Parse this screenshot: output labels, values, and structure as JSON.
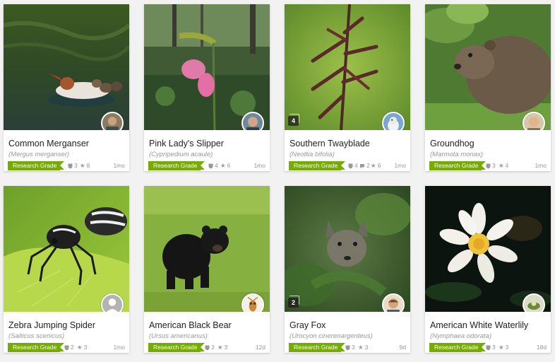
{
  "colors": {
    "badge": "#74ac00",
    "muted": "#999999",
    "card_bg": "#ffffff",
    "page_bg": "#f2f2f2"
  },
  "cards": [
    {
      "common_name": "Common Merganser",
      "scientific_name": "(Mergus merganser)",
      "quality": "Research Grade",
      "identifications": "3",
      "faves": "8",
      "age": "1mo",
      "photo_icon": "merganser-photo",
      "avatar_icon": "user-photo-avatar"
    },
    {
      "common_name": "Pink Lady's Slipper",
      "scientific_name": "(Cypripedium acaule)",
      "quality": "Research Grade",
      "identifications": "4",
      "faves": "6",
      "age": "1mo",
      "photo_icon": "orchid-photo",
      "avatar_icon": "user-photo-avatar"
    },
    {
      "common_name": "Southern Twayblade",
      "scientific_name": "(Neottia bifolia)",
      "quality": "Research Grade",
      "identifications": "4",
      "comments": "2",
      "faves": "6",
      "age": "1mo",
      "photo_count": "4",
      "photo_icon": "twayblade-photo",
      "avatar_icon": "bird-avatar"
    },
    {
      "common_name": "Groundhog",
      "scientific_name": "(Marmota monax)",
      "quality": "Research Grade",
      "identifications": "3",
      "faves": "4",
      "age": "1mo",
      "photo_icon": "groundhog-photo",
      "avatar_icon": "user-photo-avatar"
    },
    {
      "common_name": "Zebra Jumping Spider",
      "scientific_name": "(Salticus scenicus)",
      "quality": "Research Grade",
      "identifications": "2",
      "faves": "3",
      "age": "1mo",
      "photo_icon": "spider-photo",
      "avatar_icon": "default-user-avatar"
    },
    {
      "common_name": "American Black Bear",
      "scientific_name": "(Ursus americanus)",
      "quality": "Research Grade",
      "identifications": "3",
      "faves": "3",
      "age": "12d",
      "photo_icon": "bear-photo",
      "avatar_icon": "insect-avatar"
    },
    {
      "common_name": "Gray Fox",
      "scientific_name": "(Urocyon cinereoargenteus)",
      "quality": "Research Grade",
      "identifications": "3",
      "faves": "3",
      "age": "9d",
      "photo_count": "2",
      "photo_icon": "fox-photo",
      "avatar_icon": "user-photo-avatar"
    },
    {
      "common_name": "American White Waterlily",
      "scientific_name": "(Nymphaea odorata)",
      "quality": "Research Grade",
      "identifications": "3",
      "faves": "3",
      "age": "18d",
      "photo_icon": "waterlily-photo",
      "avatar_icon": "plant-avatar"
    }
  ]
}
